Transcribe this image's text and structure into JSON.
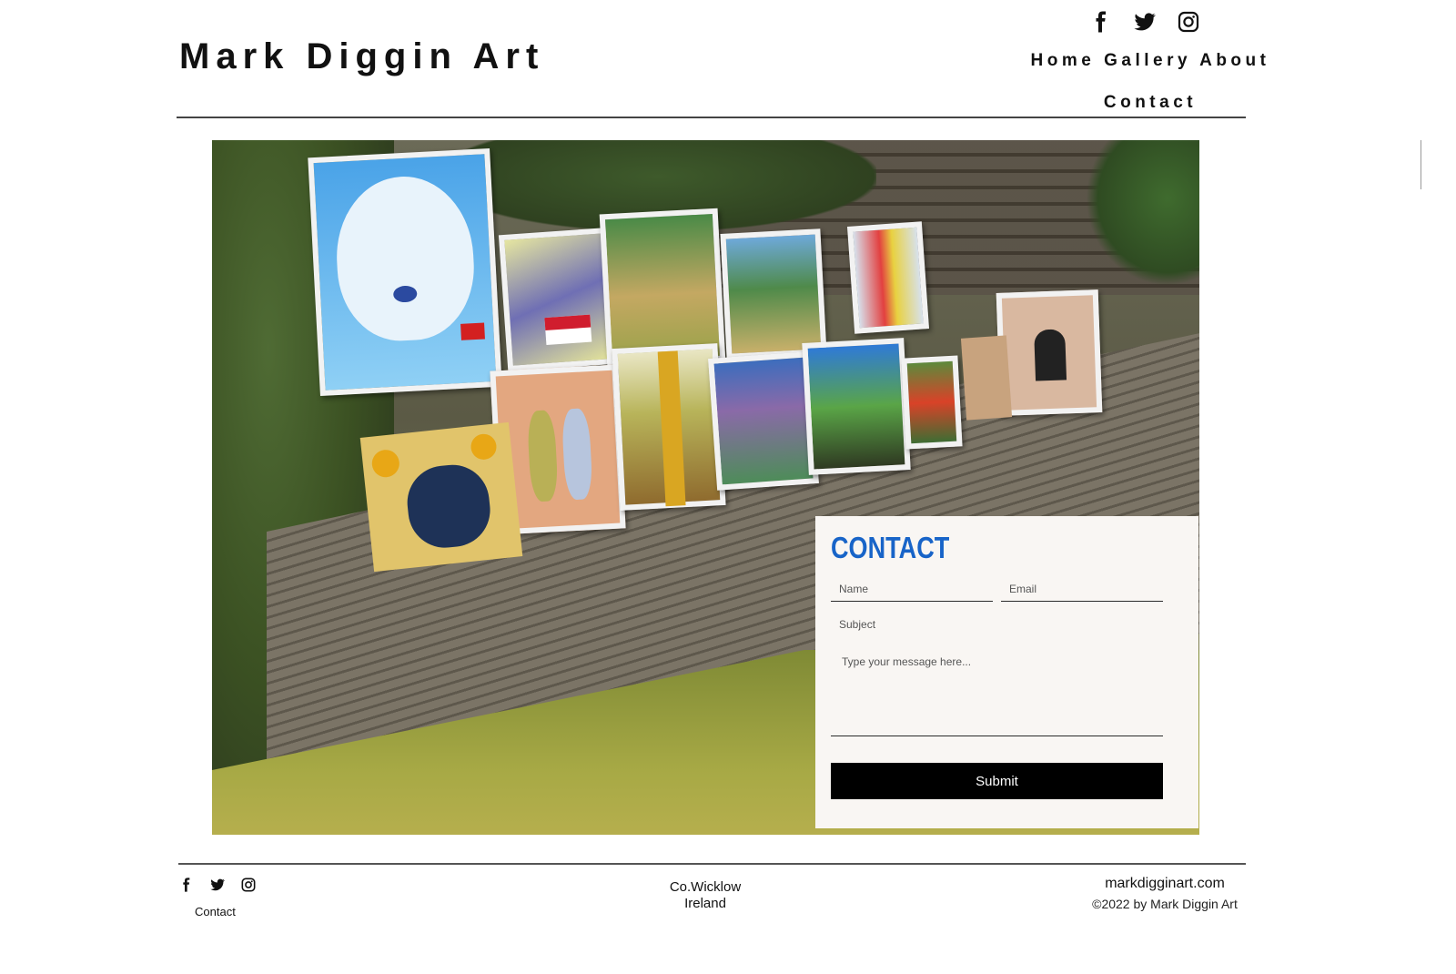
{
  "header": {
    "site_title": "Mark Diggin Art",
    "social_icons": [
      "facebook-icon",
      "twitter-icon",
      "instagram-icon"
    ],
    "nav": {
      "home": "Home",
      "gallery": "Gallery",
      "about": "About",
      "contact": "Contact"
    }
  },
  "contact_form": {
    "heading": "CONTACT",
    "name_placeholder": "Name",
    "email_placeholder": "Email",
    "subject_placeholder": "Subject",
    "message_placeholder": "Type your message here...",
    "submit_label": "Submit"
  },
  "footer": {
    "social_icons": [
      "facebook-icon",
      "twitter-icon",
      "instagram-icon"
    ],
    "contact_link": "Contact",
    "location_line1": "Co.Wicklow",
    "location_line2": "Ireland",
    "website": "markdigginart.com",
    "copyright": "©2022 by Mark Diggin Art"
  },
  "colors": {
    "contact_heading": "#1864c8",
    "panel_background": "#f9f6f3",
    "submit_background": "#000000"
  }
}
